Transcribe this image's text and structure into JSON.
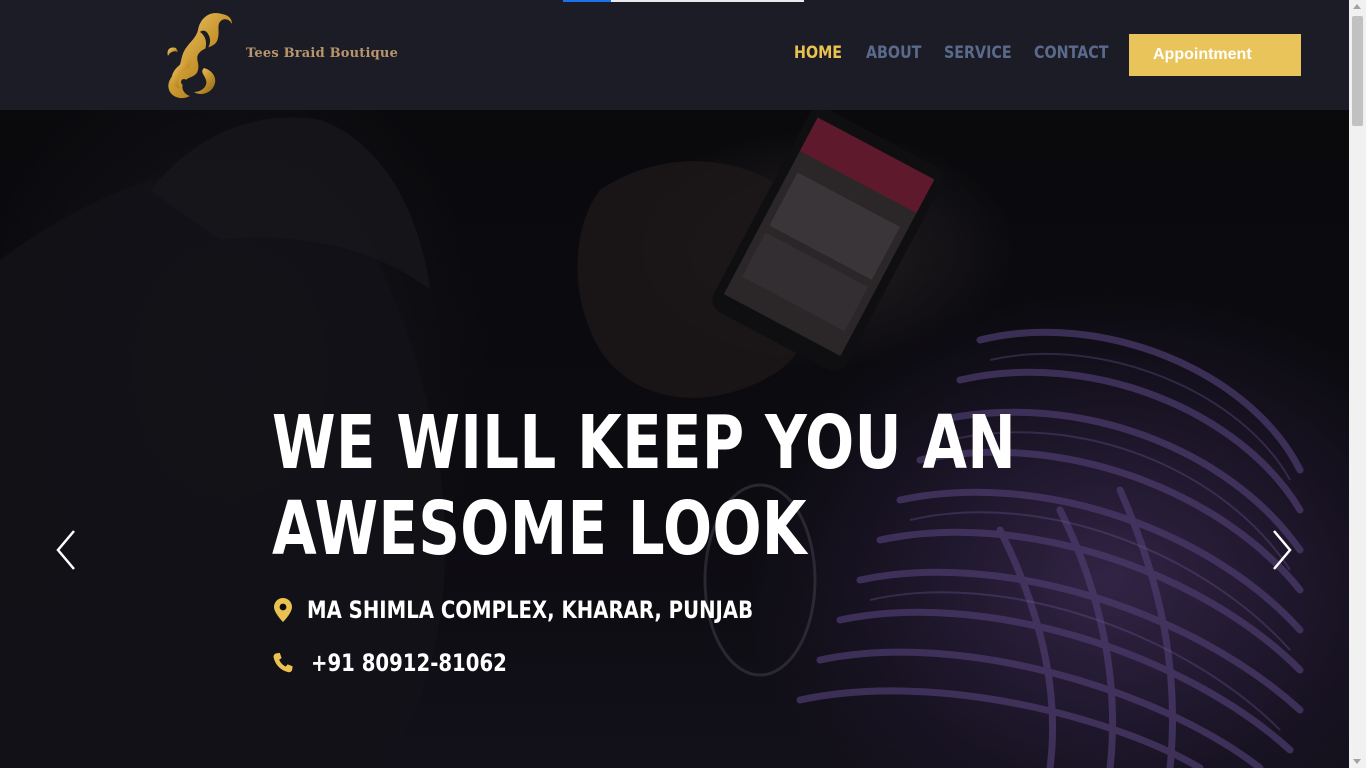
{
  "brand": {
    "name": "Tees Braid Boutique",
    "logo_icon": "golden-hair-silhouette"
  },
  "nav": {
    "items": [
      {
        "label": "HOME",
        "active": true
      },
      {
        "label": "ABOUT",
        "active": false
      },
      {
        "label": "SERVICE",
        "active": false
      },
      {
        "label": "CONTACT",
        "active": false
      }
    ],
    "cta_label": "Appointment"
  },
  "hero": {
    "headline_line1": "WE WILL KEEP YOU AN",
    "headline_line2": "AWESOME LOOK",
    "address": "MA SHIMLA COMPLEX, KHARAR, PUNJAB",
    "address_icon": "map-pin-icon",
    "phone": "+91 80912-81062",
    "phone_icon": "phone-icon",
    "prev_icon": "chevron-left-icon",
    "next_icon": "chevron-right-icon"
  },
  "colors": {
    "header_bg": "#1b1c26",
    "accent": "#e9c24f",
    "nav_inactive": "#5b6a8c",
    "brand_text": "#b8956a",
    "button_bg": "#e9c45b"
  }
}
